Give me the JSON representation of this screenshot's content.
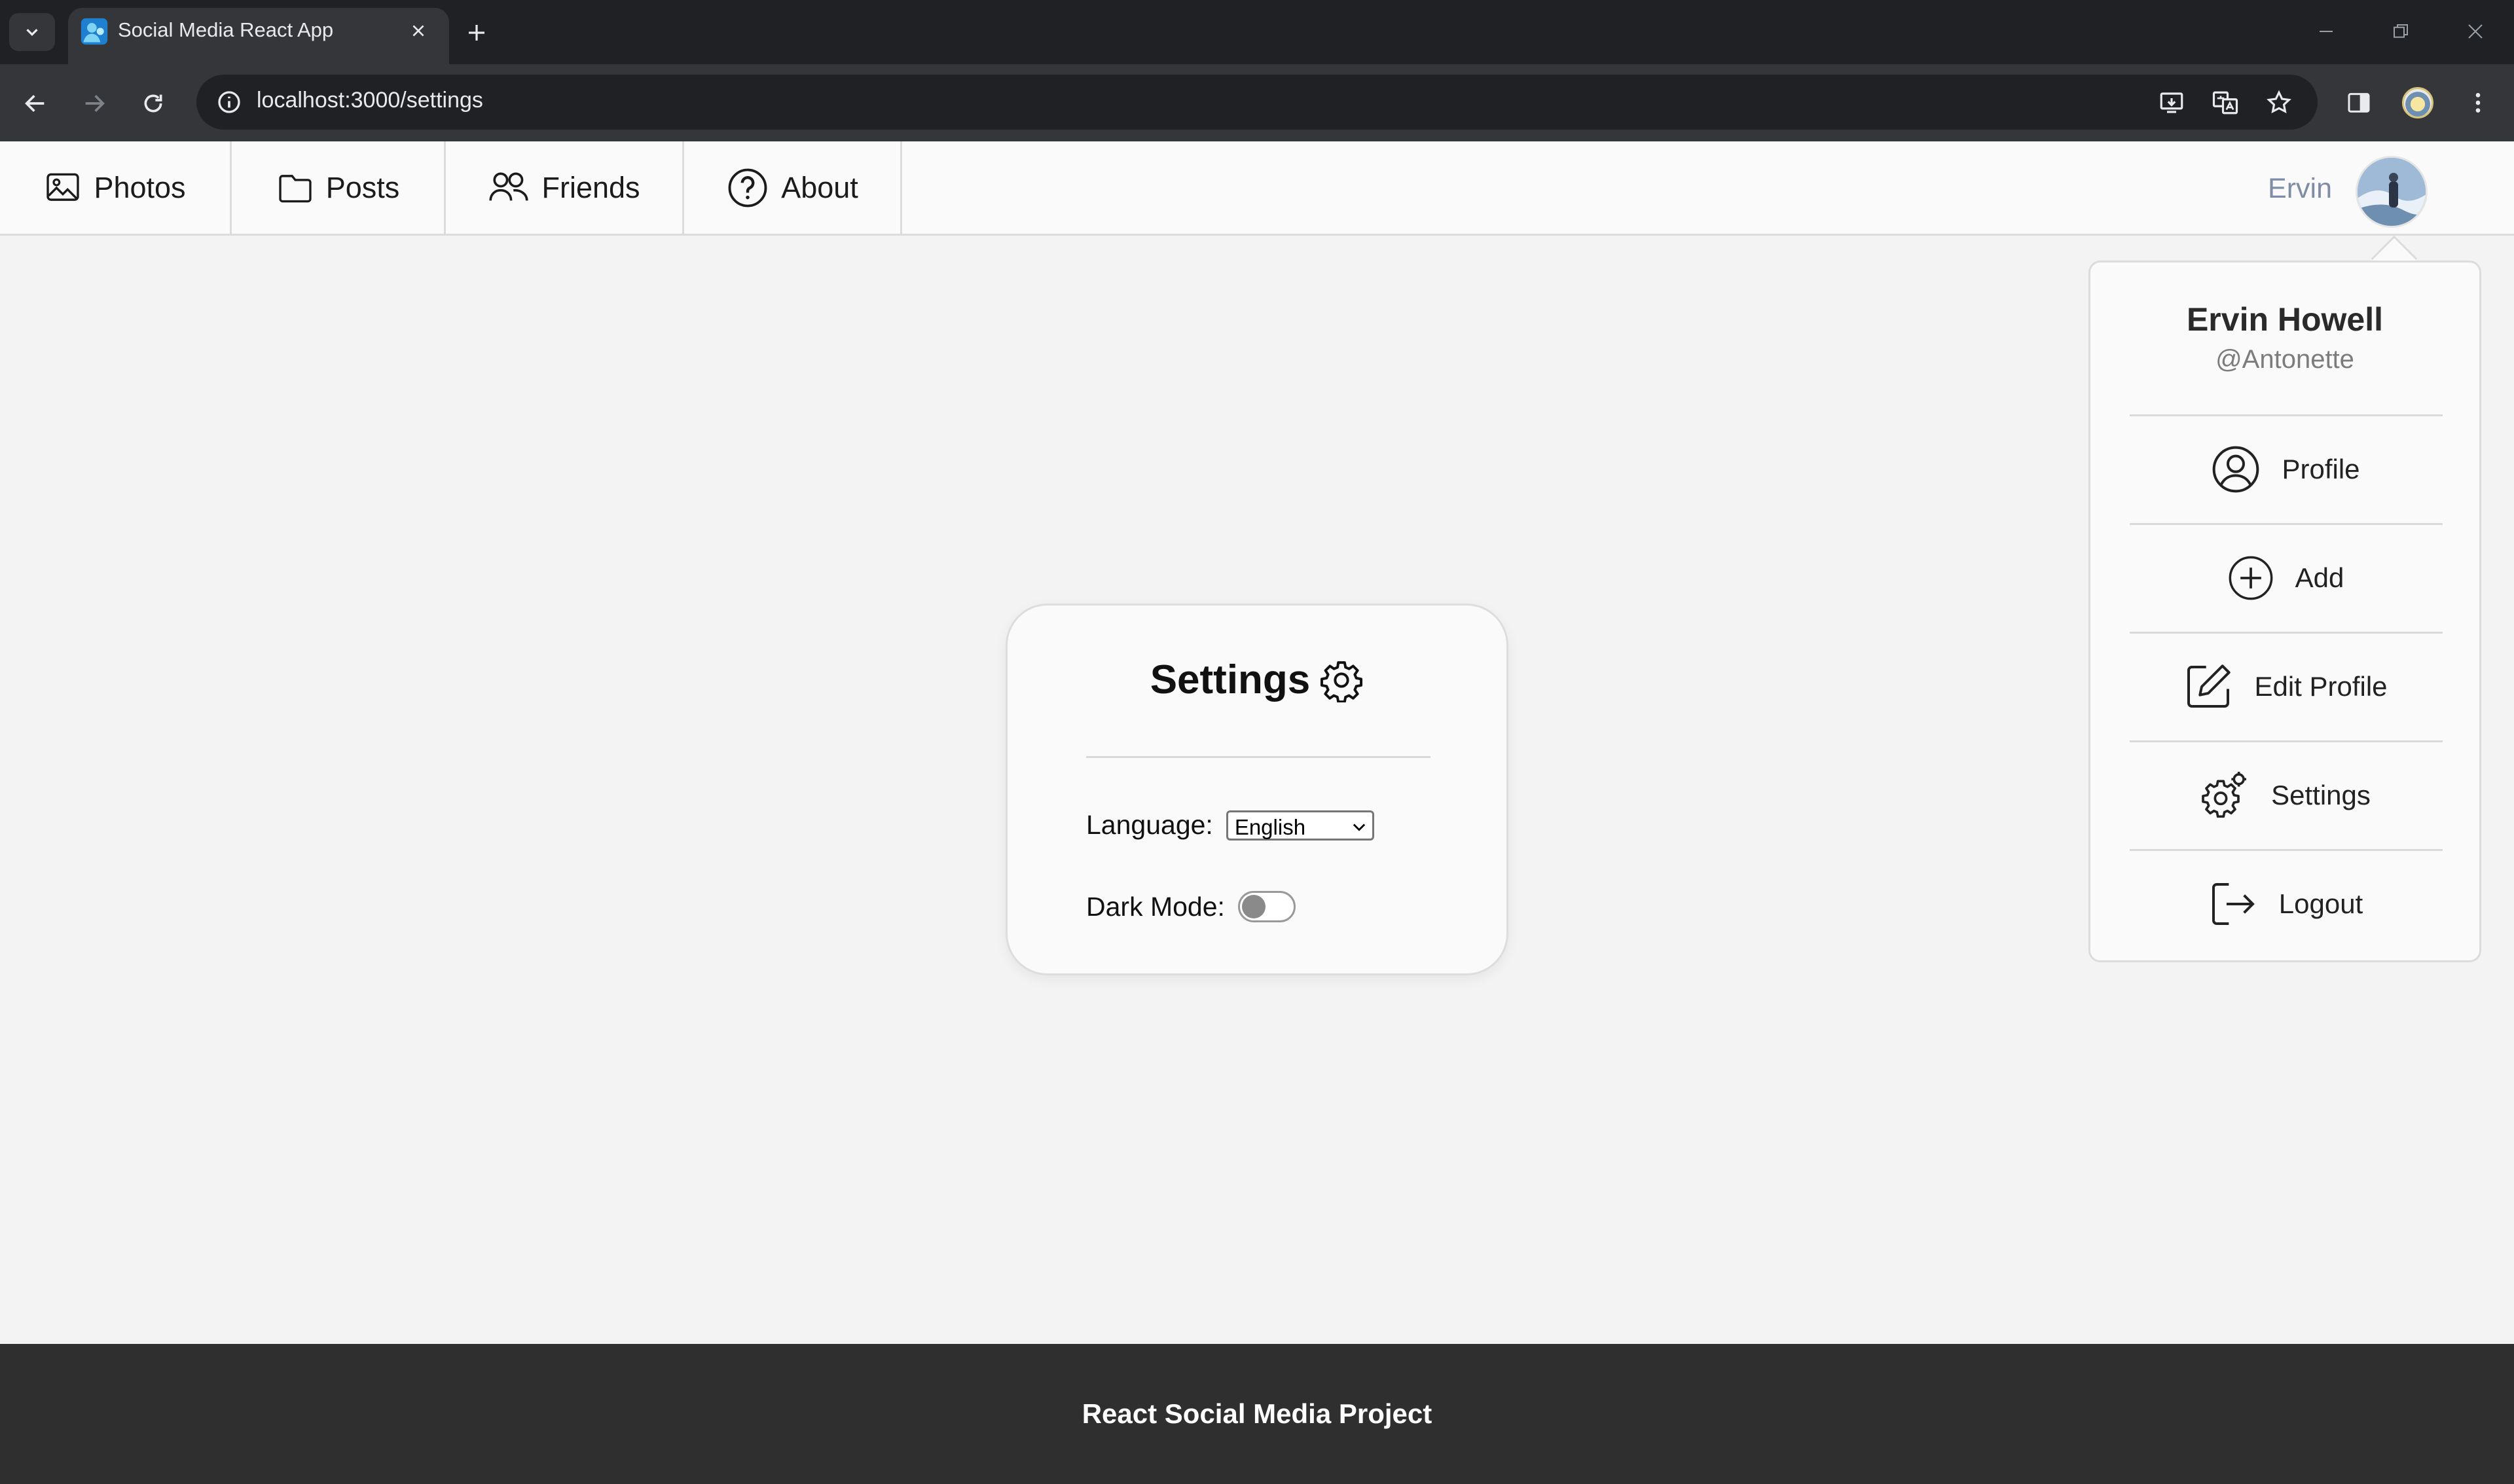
{
  "browser": {
    "tab_title": "Social Media React App",
    "url": "localhost:3000/settings"
  },
  "nav": {
    "items": [
      {
        "label": "Photos",
        "icon": "image-icon"
      },
      {
        "label": "Posts",
        "icon": "folder-icon"
      },
      {
        "label": "Friends",
        "icon": "users-icon"
      },
      {
        "label": "About",
        "icon": "question-circle-icon"
      }
    ],
    "user_name": "Ervin"
  },
  "settings": {
    "title": "Settings",
    "language_label": "Language:",
    "language_value": "English",
    "dark_mode_label": "Dark Mode:",
    "dark_mode_on": false
  },
  "dropdown": {
    "full_name": "Ervin Howell",
    "handle": "@Antonette",
    "items": [
      {
        "label": "Profile",
        "icon": "user-circle-icon"
      },
      {
        "label": "Add",
        "icon": "plus-circle-icon"
      },
      {
        "label": "Edit Profile",
        "icon": "edit-icon"
      },
      {
        "label": "Settings",
        "icon": "gear-icon"
      },
      {
        "label": "Logout",
        "icon": "logout-icon"
      }
    ]
  },
  "footer": {
    "text": "React Social Media Project"
  },
  "colors": {
    "chrome_dark": "#202124",
    "chrome_toolbar": "#35363a",
    "nav_bg": "#fafafa",
    "page_bg": "#f3f3f3",
    "footer_bg": "#2f2f2f",
    "user_name": "#7e8ca6"
  }
}
